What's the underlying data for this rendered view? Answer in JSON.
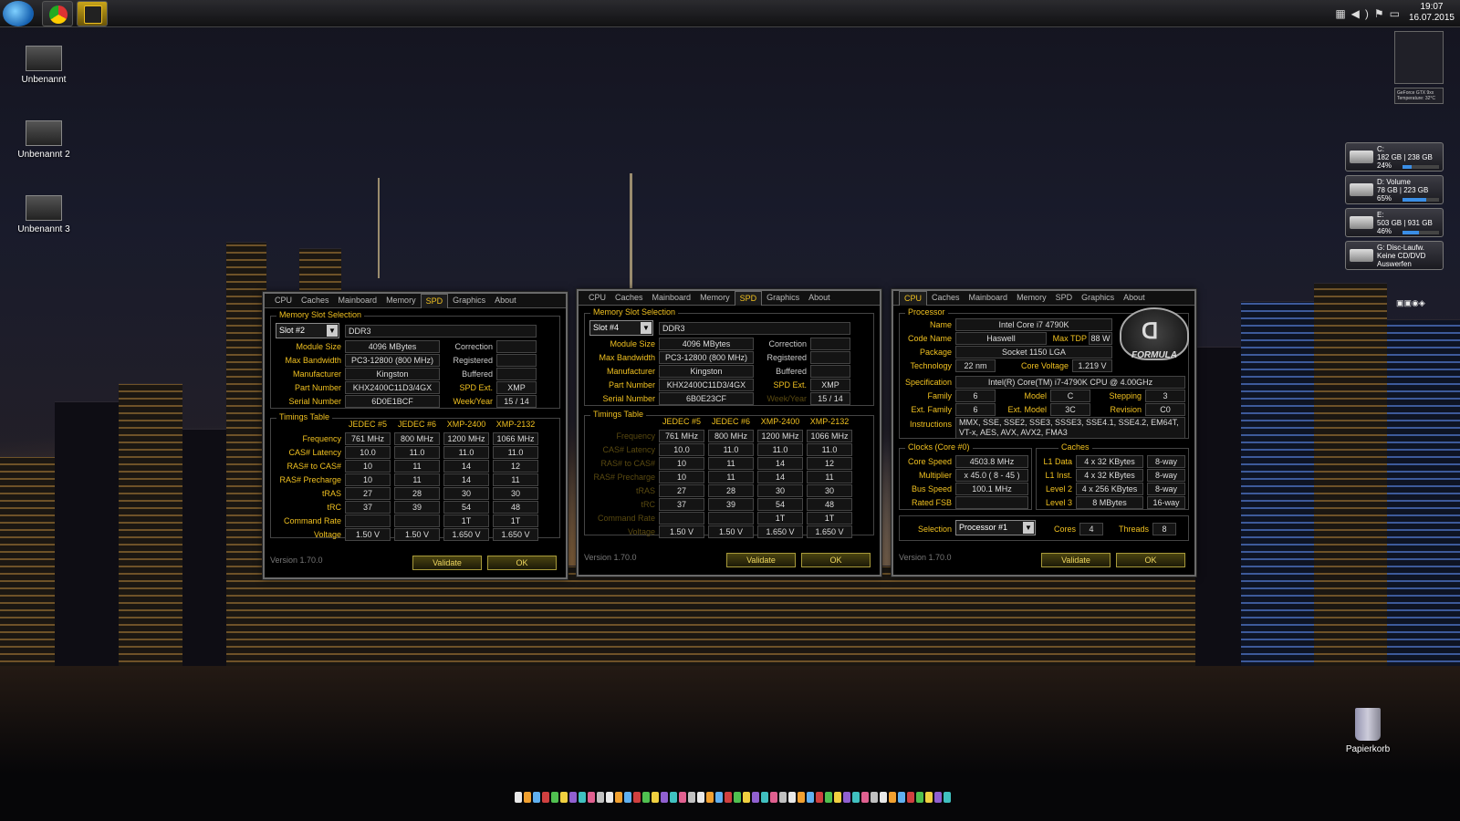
{
  "taskbar": {
    "clock_time": "19:07",
    "clock_date": "16.07.2015",
    "tray_icons": [
      "network-icon",
      "volume-icon",
      "flag-icon",
      "display-icon"
    ]
  },
  "desktop_icons": [
    {
      "label": "Unbenannt"
    },
    {
      "label": "Unbenannt 2"
    },
    {
      "label": "Unbenannt 3"
    }
  ],
  "recycle_bin": {
    "label": "Papierkorb"
  },
  "gadgets": {
    "drives": [
      {
        "line1": "C:",
        "line2": "182 GB | 238 GB",
        "line3": "24%",
        "fill": 0.24
      },
      {
        "line1": "D: Volume",
        "line2": "78 GB | 223 GB",
        "line3": "65%",
        "fill": 0.65
      },
      {
        "line1": "E:",
        "line2": "503 GB | 931 GB",
        "line3": "46%",
        "fill": 0.46
      },
      {
        "line1": "G: Disc-Laufw.",
        "line2": "Keine CD/DVD",
        "line3": "Auswerfen",
        "fill": 0
      }
    ],
    "gpu_label": "GeForce GTX 9xx",
    "gpu_temp": "Temperature: 32°C"
  },
  "tabs": [
    "CPU",
    "Caches",
    "Mainboard",
    "Memory",
    "SPD",
    "Graphics",
    "About"
  ],
  "spd_labels": {
    "section": "Memory Slot Selection",
    "module_size": "Module Size",
    "max_bandwidth": "Max Bandwidth",
    "manufacturer": "Manufacturer",
    "part_number": "Part Number",
    "serial_number": "Serial Number",
    "correction": "Correction",
    "registered": "Registered",
    "buffered": "Buffered",
    "spd_ext": "SPD Ext.",
    "week_year": "Week/Year",
    "timings": "Timings Table",
    "frequency": "Frequency",
    "cas": "CAS# Latency",
    "ras_cas": "RAS# to CAS#",
    "ras_pre": "RAS# Precharge",
    "tras": "tRAS",
    "trc": "tRC",
    "cmd_rate": "Command Rate",
    "voltage": "Voltage"
  },
  "timing_headers": [
    "JEDEC #5",
    "JEDEC #6",
    "XMP-2400",
    "XMP-2132"
  ],
  "spd1": {
    "slot": "Slot #2",
    "type": "DDR3",
    "module_size": "4096 MBytes",
    "max_bandwidth": "PC3-12800 (800 MHz)",
    "manufacturer": "Kingston",
    "part_number": "KHX2400C11D3/4GX",
    "serial_number": "6D0E1BCF",
    "spd_ext": "XMP",
    "week_year": "15 / 14",
    "rows": [
      [
        "761 MHz",
        "800 MHz",
        "1200 MHz",
        "1066 MHz"
      ],
      [
        "10.0",
        "11.0",
        "11.0",
        "11.0"
      ],
      [
        "10",
        "11",
        "14",
        "12"
      ],
      [
        "10",
        "11",
        "14",
        "11"
      ],
      [
        "27",
        "28",
        "30",
        "30"
      ],
      [
        "37",
        "39",
        "54",
        "48"
      ],
      [
        "",
        "",
        "1T",
        "1T"
      ],
      [
        "1.50 V",
        "1.50 V",
        "1.650 V",
        "1.650 V"
      ]
    ]
  },
  "spd2": {
    "slot": "Slot #4",
    "type": "DDR3",
    "module_size": "4096 MBytes",
    "max_bandwidth": "PC3-12800 (800 MHz)",
    "manufacturer": "Kingston",
    "part_number": "KHX2400C11D3/4GX",
    "serial_number": "6B0E23CF",
    "spd_ext": "XMP",
    "week_year": "15 / 14",
    "rows": [
      [
        "761 MHz",
        "800 MHz",
        "1200 MHz",
        "1066 MHz"
      ],
      [
        "10.0",
        "11.0",
        "11.0",
        "11.0"
      ],
      [
        "10",
        "11",
        "14",
        "12"
      ],
      [
        "10",
        "11",
        "14",
        "11"
      ],
      [
        "27",
        "28",
        "30",
        "30"
      ],
      [
        "37",
        "39",
        "54",
        "48"
      ],
      [
        "",
        "",
        "1T",
        "1T"
      ],
      [
        "1.50 V",
        "1.50 V",
        "1.650 V",
        "1.650 V"
      ]
    ]
  },
  "version": "Version 1.70.0",
  "buttons": {
    "validate": "Validate",
    "ok": "OK"
  },
  "cpu": {
    "labels": {
      "processor": "Processor",
      "name": "Name",
      "code_name": "Code Name",
      "max_tdp": "Max TDP",
      "package": "Package",
      "technology": "Technology",
      "core_voltage": "Core Voltage",
      "specification": "Specification",
      "family": "Family",
      "model": "Model",
      "stepping": "Stepping",
      "ext_family": "Ext. Family",
      "ext_model": "Ext. Model",
      "revision": "Revision",
      "instructions": "Instructions",
      "clocks": "Clocks (Core #0)",
      "core_speed": "Core Speed",
      "multiplier": "Multiplier",
      "bus_speed": "Bus Speed",
      "rated_fsb": "Rated FSB",
      "caches": "Caches",
      "l1_data": "L1 Data",
      "l1_inst": "L1 Inst.",
      "level2": "Level 2",
      "level3": "Level 3",
      "selection": "Selection",
      "cores": "Cores",
      "threads": "Threads"
    },
    "name": "Intel Core i7 4790K",
    "code_name": "Haswell",
    "max_tdp": "88 W",
    "package": "Socket 1150 LGA",
    "technology": "22 nm",
    "core_voltage": "1.219 V",
    "specification": "Intel(R) Core(TM) i7-4790K CPU @ 4.00GHz",
    "family": "6",
    "model": "C",
    "stepping": "3",
    "ext_family": "6",
    "ext_model": "3C",
    "revision": "C0",
    "instructions_1": "MMX, SSE, SSE2, SSE3, SSSE3, SSE4.1, SSE4.2, EM64T,",
    "instructions_2": "VT-x, AES, AVX, AVX2, FMA3",
    "core_speed": "4503.8 MHz",
    "multiplier": "x 45.0 ( 8 - 45 )",
    "bus_speed": "100.1 MHz",
    "rated_fsb": "",
    "l1_data": "4 x 32 KBytes",
    "l1_data_way": "8-way",
    "l1_inst": "4 x 32 KBytes",
    "l1_inst_way": "8-way",
    "level2": "4 x 256 KBytes",
    "level2_way": "8-way",
    "level3": "8 MBytes",
    "level3_way": "16-way",
    "selection": "Processor #1",
    "cores": "4",
    "threads": "8",
    "logo_text": "FORMULA"
  }
}
